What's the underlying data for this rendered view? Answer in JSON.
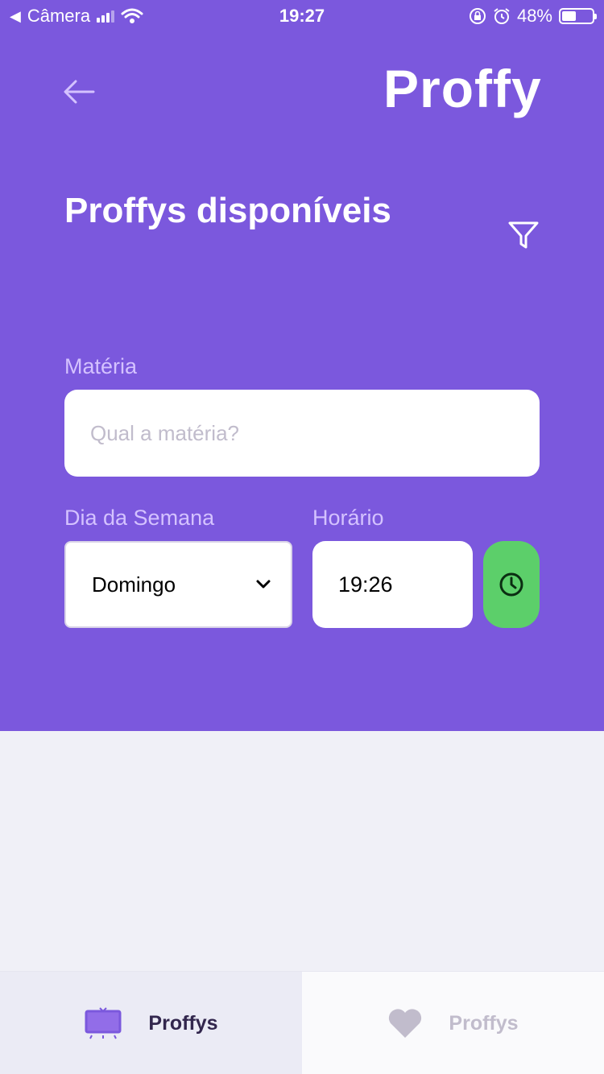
{
  "status_bar": {
    "back_app": "Câmera",
    "time": "19:27",
    "battery_percent": "48%",
    "battery_level": 0.48
  },
  "header": {
    "logo": "Proffy",
    "title": "Proffys disponíveis",
    "background_color": "#7b58dd"
  },
  "filters": {
    "subject_label": "Matéria",
    "subject_placeholder": "Qual a matéria?",
    "day_label": "Dia da Semana",
    "day_value": "Domingo",
    "time_label": "Horário",
    "time_value": "19:26",
    "clock_button_color": "#5ccf6a"
  },
  "tabs": [
    {
      "label": "Proffys",
      "icon": "tv-icon",
      "active": true
    },
    {
      "label": "Proffys",
      "icon": "heart-icon",
      "active": false
    }
  ]
}
